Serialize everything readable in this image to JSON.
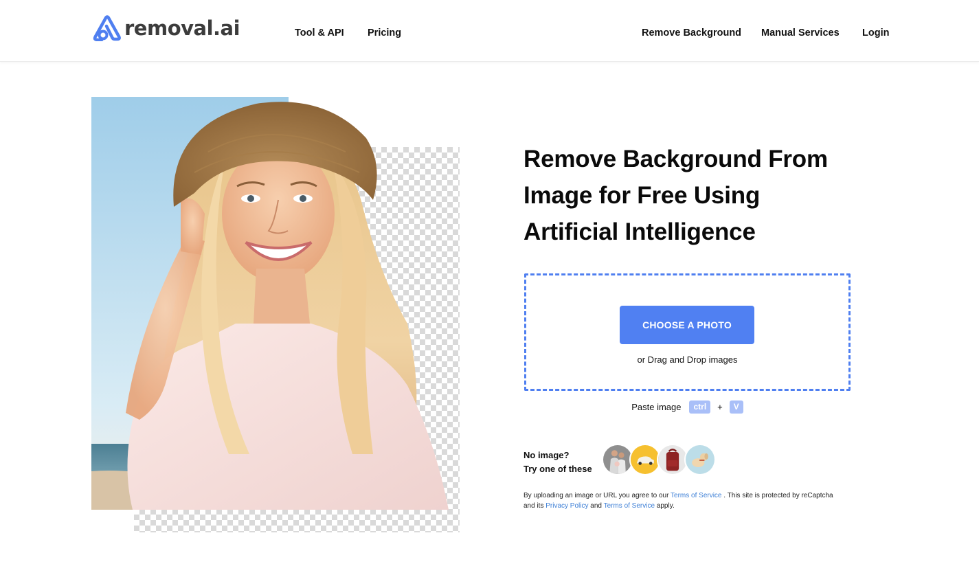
{
  "brand": {
    "name": "removal.ai",
    "accent_color": "#4f7ff0",
    "button_color": "#5080f2"
  },
  "nav": {
    "left": [
      {
        "label": "Tool & API"
      },
      {
        "label": "Pricing"
      }
    ],
    "right": [
      {
        "label": "Remove Background"
      },
      {
        "label": "Manual Services"
      },
      {
        "label": "Login"
      }
    ]
  },
  "hero": {
    "image_alt": "Smiling woman in straw hat on beach with background partially removed (transparency checkerboard)",
    "title": "Remove Background From Image for Free Using Artificial Intelligence"
  },
  "upload": {
    "button_label": "CHOOSE A PHOTO",
    "drag_text": "or Drag and Drop images",
    "paste_label": "Paste image",
    "paste_key_1": "ctrl",
    "paste_plus": "+",
    "paste_key_2": "V"
  },
  "samples": {
    "line1": "No image?",
    "line2": "Try one of these",
    "items": [
      {
        "name": "family",
        "alt": "Family photo"
      },
      {
        "name": "car",
        "alt": "White car on yellow background"
      },
      {
        "name": "backpack",
        "alt": "Red backpack"
      },
      {
        "name": "dog",
        "alt": "Puppy on light blue background"
      }
    ]
  },
  "legal": {
    "part1": "By uploading an image or URL you agree to our ",
    "link1": "Terms of Service",
    "part2": " . This site is protected by reCaptcha and its ",
    "link2": "Privacy Policy",
    "part3": " and ",
    "link3": "Terms of Service",
    "part4": " apply."
  }
}
